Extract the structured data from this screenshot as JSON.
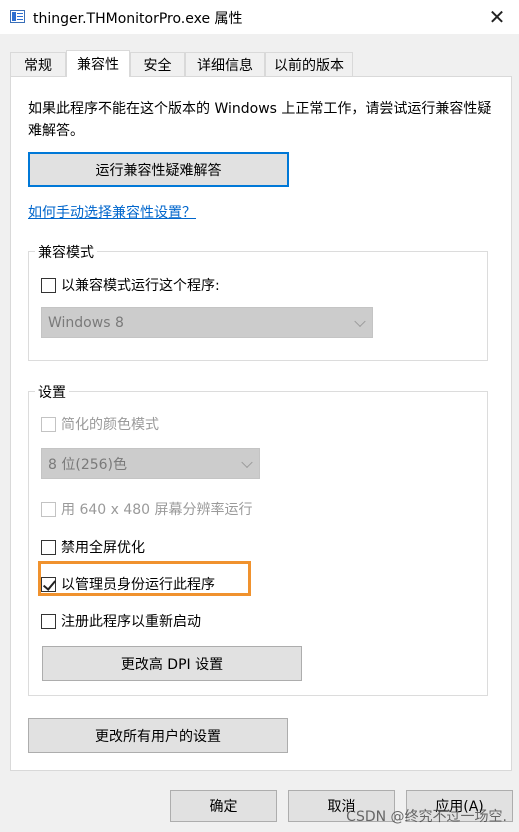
{
  "window": {
    "title": "thinger.THMonitorPro.exe 属性"
  },
  "tabs": [
    {
      "label": "常规"
    },
    {
      "label": "兼容性"
    },
    {
      "label": "安全"
    },
    {
      "label": "详细信息"
    },
    {
      "label": "以前的版本"
    }
  ],
  "compat": {
    "intro": "如果此程序不能在这个版本的 Windows 上正常工作，请尝试运行兼容性疑难解答。",
    "troubleshoot_button": "运行兼容性疑难解答",
    "manual_link": "如何手动选择兼容性设置？",
    "mode_group": {
      "title": "兼容模式",
      "checkbox": "以兼容模式运行这个程序:",
      "select_value": "Windows 8"
    },
    "settings_group": {
      "title": "设置",
      "reduced_color": "简化的颜色模式",
      "color_select": "8 位(256)色",
      "run_640": "用 640 x 480 屏幕分辨率运行",
      "disable_fullscreen": "禁用全屏优化",
      "run_as_admin": "以管理员身份运行此程序",
      "register_restart": "注册此程序以重新启动",
      "dpi_button": "更改高 DPI 设置"
    },
    "all_users_button": "更改所有用户的设置"
  },
  "footer": {
    "ok": "确定",
    "cancel": "取消",
    "apply": "应用(A)"
  },
  "watermark": "CSDN @终究不过一场空."
}
